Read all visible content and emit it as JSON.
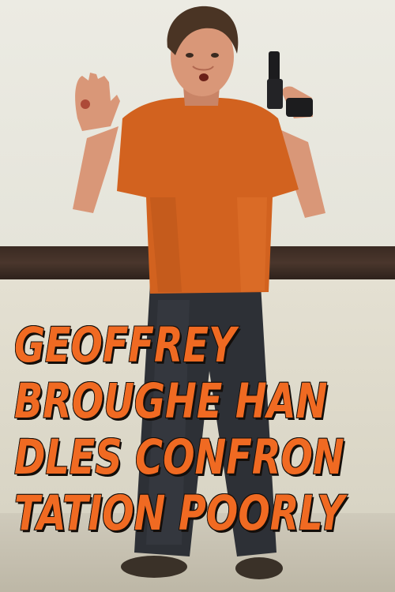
{
  "poster": {
    "title_lines": [
      "GEOFFREY",
      "BROUGHE HAN",
      "DLES CONFRON",
      "TATION POORLY"
    ],
    "colors": {
      "title_fill": "#f06a22",
      "title_outline": "#1a1410",
      "shirt": "#d2621f",
      "wall": "#ecebe3",
      "rail": "#3a2a22"
    }
  }
}
